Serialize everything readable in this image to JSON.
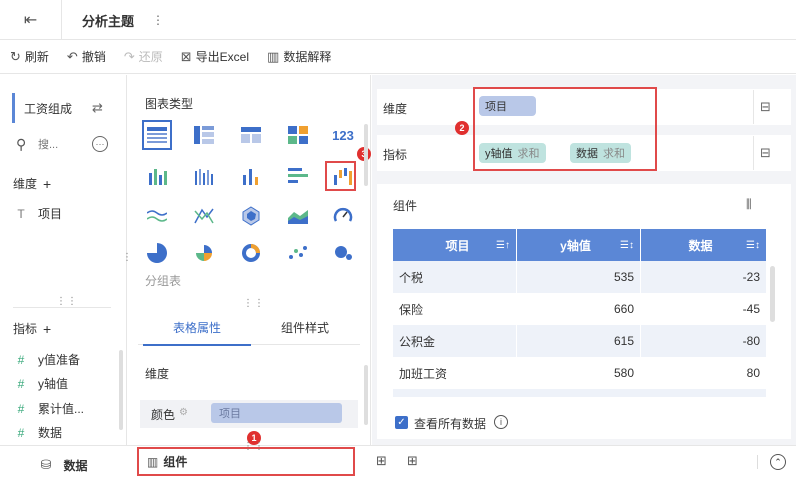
{
  "tab": {
    "title": "分析主题",
    "more": "⋮"
  },
  "toolbar": {
    "refresh": "刷新",
    "undo": "撤销",
    "redo": "还原",
    "export": "导出Excel",
    "explain": "数据解释"
  },
  "data_panel": {
    "dataset": "工资组成",
    "search_placeholder": "搜...",
    "dimension_title": "维度",
    "dimension_items": [
      "项目"
    ],
    "metric_title": "指标",
    "metric_items": [
      "y值准备",
      "y轴值",
      "累计值...",
      "数据"
    ]
  },
  "component_panel": {
    "chart_type_title": "图表类型",
    "group_label": "分组表",
    "tabs": [
      "表格属性",
      "组件样式"
    ],
    "dimension_label": "维度",
    "color_label": "颜色",
    "color_value": "项目"
  },
  "shelves": {
    "dimension_label": "维度",
    "dimension_pill": "项目",
    "metric_label": "指标",
    "metric_pills": [
      {
        "name": "y轴值",
        "agg": "求和"
      },
      {
        "name": "数据",
        "agg": "求和"
      }
    ]
  },
  "component": {
    "title": "组件",
    "columns": [
      "项目",
      "y轴值",
      "数据"
    ],
    "rows": [
      [
        "个税",
        "535",
        "-23"
      ],
      [
        "保险",
        "660",
        "-45"
      ],
      [
        "公积金",
        "615",
        "-80"
      ],
      [
        "加班工资",
        "580",
        "80"
      ]
    ],
    "view_all_label": "查看所有数据"
  },
  "bottom": {
    "data_tab": "数据",
    "component_tab": "组件"
  },
  "badges": [
    "1",
    "2",
    "3"
  ],
  "colors": {
    "accent": "#3d6fc9",
    "table_header": "#5b87d6",
    "highlight": "#e04a4a",
    "dimension_pill": "#b9c8e8",
    "metric_pill": "#bfe3df"
  }
}
